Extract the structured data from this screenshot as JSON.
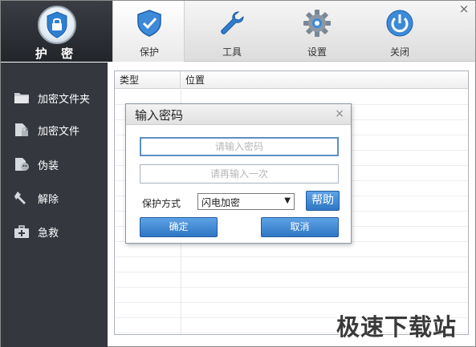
{
  "window": {
    "close_glyph": "×"
  },
  "logo": {
    "label": "护 密",
    "icon": "shield-lock-icon"
  },
  "tabs": [
    {
      "label": "保护",
      "icon": "shield-icon",
      "active": true
    },
    {
      "label": "工具",
      "icon": "wrench-icon",
      "active": false
    },
    {
      "label": "设置",
      "icon": "gear-icon",
      "active": false
    },
    {
      "label": "关闭",
      "icon": "power-icon",
      "active": false
    }
  ],
  "sidebar": {
    "items": [
      {
        "label": "加密文件夹",
        "icon": "folder-icon"
      },
      {
        "label": "加密文件",
        "icon": "file-lock-icon"
      },
      {
        "label": "伪装",
        "icon": "disguise-icon"
      },
      {
        "label": "解除",
        "icon": "unlock-tool-icon"
      },
      {
        "label": "急救",
        "icon": "first-aid-kit-icon"
      }
    ]
  },
  "list": {
    "columns": [
      "类型",
      "位置"
    ],
    "rows": []
  },
  "dialog": {
    "title": "输入密码",
    "close_glyph": "×",
    "password_placeholder": "请输入密码",
    "confirm_placeholder": "请再输入一次",
    "method_label": "保护方式",
    "method_value": "闪电加密",
    "help_label": "帮助",
    "ok_label": "确定",
    "cancel_label": "取消"
  },
  "watermark": "极速下载站",
  "colors": {
    "sidebar_bg": "#34373e",
    "accent_blue": "#2f76c4",
    "focus_border": "#5b8fc7"
  }
}
